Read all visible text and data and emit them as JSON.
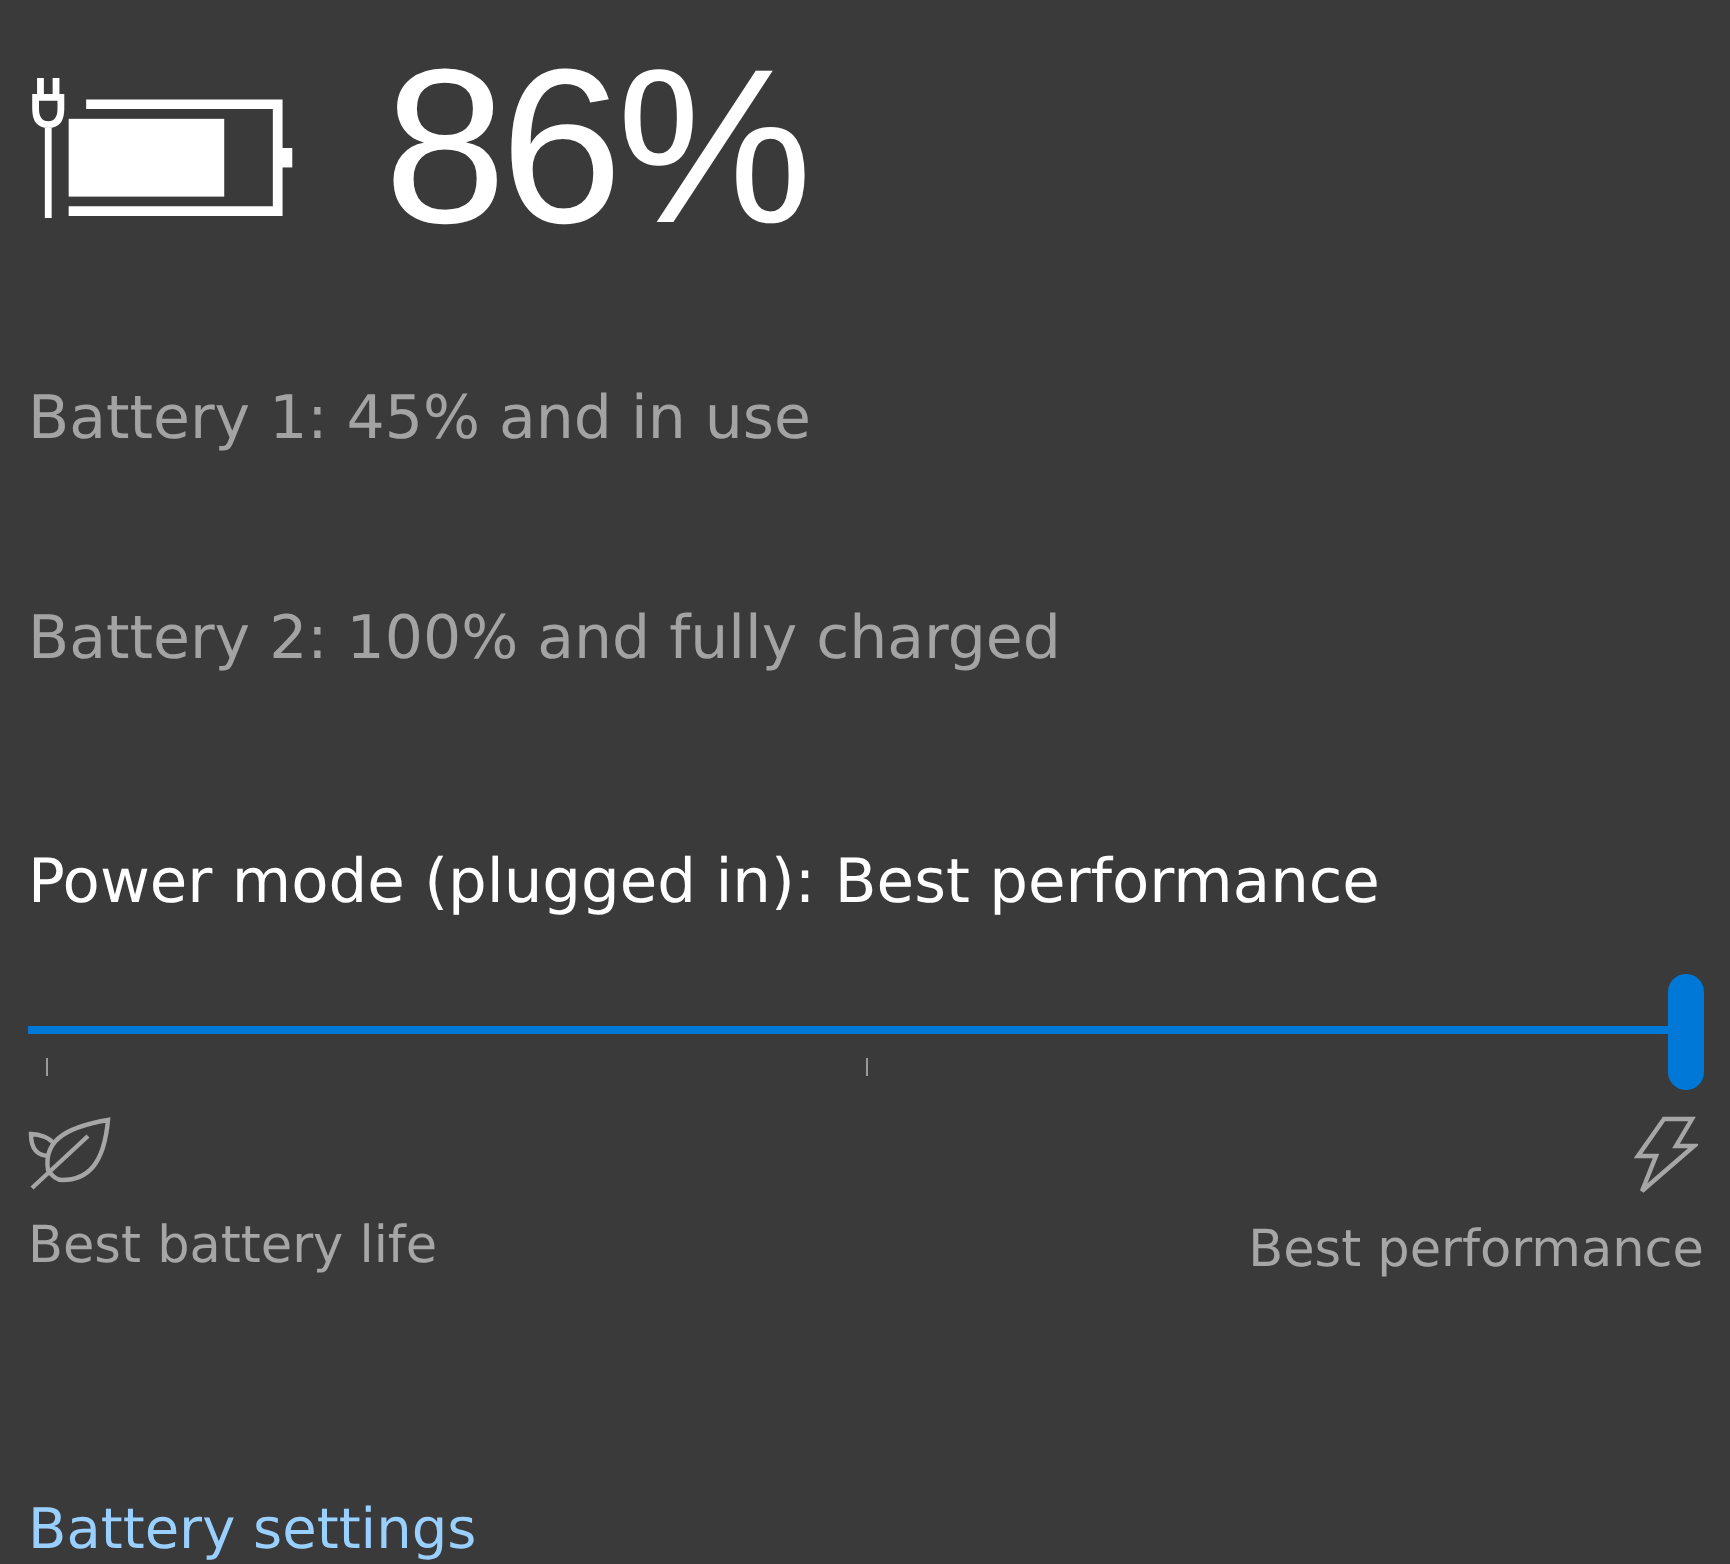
{
  "battery": {
    "plugged_in": true,
    "percent": "86%"
  },
  "battery_details": [
    "Battery 1: 45% and in use",
    "Battery 2: 100% and fully charged"
  ],
  "power_mode": {
    "label": "Power mode (plugged in): Best performance",
    "level": 1,
    "min_label": "Best battery life",
    "max_label": "Best performance"
  },
  "link": "Battery settings"
}
